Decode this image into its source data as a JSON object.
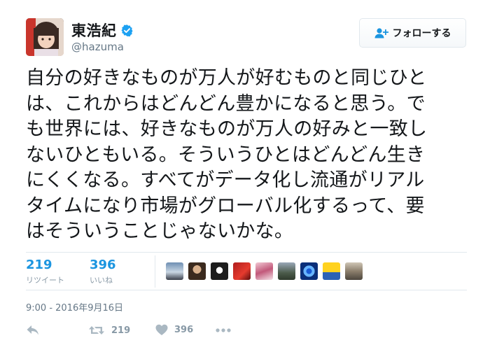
{
  "user": {
    "display_name": "東浩紀",
    "handle": "@hazuma",
    "verified": true
  },
  "follow_button": {
    "label": "フォローする",
    "icon": "add-user-icon"
  },
  "tweet": {
    "text": "自分の好きなものが万人が好むものと同じひと\nは、これからはどんどん豊かになると思う。で\nも世界には、好きなものが万人の好みと一致し\nないひともいる。そういうひとはどんどん生き\nにくくなる。すべてがデータ化し流通がリアル\nタイムになり市場がグローバル化するって、要\nはそういうことじゃないかな。",
    "timestamp": "9:00 - 2016年9月16日"
  },
  "stats": {
    "retweets": {
      "value": "219",
      "label": "リツイート"
    },
    "likes": {
      "value": "396",
      "label": "いいね"
    }
  },
  "likers_count": 9,
  "actions": {
    "reply_icon": "reply-icon",
    "retweet_icon": "retweet-icon",
    "retweet_count": "219",
    "like_icon": "heart-icon",
    "like_count": "396",
    "more_icon": "more-icon"
  },
  "colors": {
    "accent": "#1b95e0",
    "muted": "#8899a6",
    "text": "#14171a",
    "border": "#e1e8ed"
  }
}
